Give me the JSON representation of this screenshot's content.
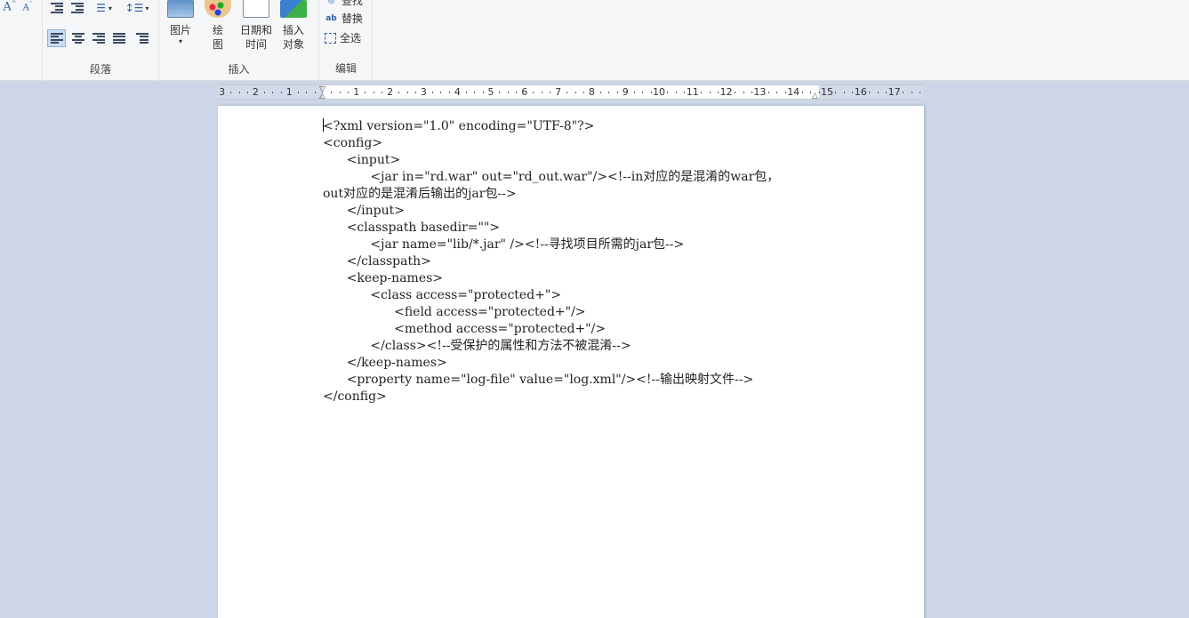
{
  "ribbon": {
    "font_group": {
      "grow_font_icon": "grow-font",
      "shrink_font_icon": "shrink-font"
    },
    "paragraph": {
      "label": "段落",
      "buttons": [
        "decrease-indent",
        "increase-indent",
        "bullet-list",
        "line-spacing",
        "align-left",
        "align-center",
        "align-right",
        "justify",
        "paragraph-settings"
      ]
    },
    "insert": {
      "label": "插入",
      "picture_label": "图片",
      "picture_arrow": "▾",
      "paint_label_1": "绘",
      "paint_label_2": "图",
      "datetime_label_1": "日期和",
      "datetime_label_2": "时间",
      "object_label_1": "插入",
      "object_label_2": "对象"
    },
    "edit": {
      "label": "编辑",
      "find_label": "查找",
      "replace_label": "替换",
      "select_all_label": "全选"
    }
  },
  "ruler": {
    "left_numbers": [
      "3",
      "2",
      "1"
    ],
    "right_numbers": [
      "1",
      "2",
      "3",
      "4",
      "5",
      "6",
      "7",
      "8",
      "9",
      "10",
      "11",
      "12",
      "13",
      "14",
      "15",
      "16",
      "17"
    ]
  },
  "document": {
    "lines": [
      "<?xml version=\"1.0\" encoding=\"UTF-8\"?>",
      "<config>",
      "      <input>",
      "            <jar in=\"rd.war\" out=\"rd_out.war\"/><!--in对应的是混淆的war包，",
      "out对应的是混淆后输出的jar包-->",
      "      </input>",
      "      <classpath basedir=\"\">",
      "            <jar name=\"lib/*.jar\" /><!--寻找项目所需的jar包-->",
      "      </classpath>",
      "      <keep-names>",
      "            <class access=\"protected+\">",
      "                  <field access=\"protected+\"/>",
      "                  <method access=\"protected+\"/>",
      "            </class><!--受保护的属性和方法不被混淆-->",
      "      </keep-names>",
      "      <property name=\"log-file\" value=\"log.xml\"/><!--输出映射文件-->",
      "</config>"
    ]
  },
  "colors": {
    "workspace": "#ccd6e6",
    "ribbon": "#f5f6f7",
    "page": "#ffffff",
    "active_button": "#c8dcf2"
  }
}
